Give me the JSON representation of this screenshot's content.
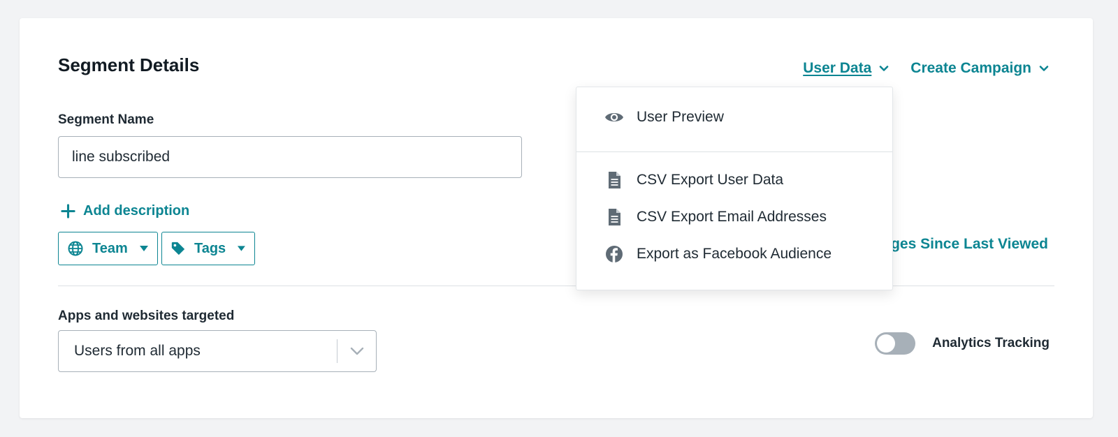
{
  "colors": {
    "accent": "#0c8592",
    "text": "#1f2a33",
    "icon": "#5f6b75"
  },
  "header": {
    "title": "Segment Details",
    "user_data_label": "User Data",
    "create_campaign_label": "Create Campaign"
  },
  "segment_name": {
    "label": "Segment Name",
    "value": "line subscribed"
  },
  "add_description_label": "Add description",
  "pills": {
    "team_label": "Team",
    "tags_label": "Tags"
  },
  "changes_link_label": "ges Since Last Viewed",
  "apps": {
    "label": "Apps and websites targeted",
    "selected": "Users from all apps"
  },
  "analytics": {
    "label": "Analytics Tracking",
    "enabled": false
  },
  "dropdown": {
    "items": [
      {
        "label": "User Preview",
        "icon": "eye-icon"
      },
      {
        "label": "CSV Export User Data",
        "icon": "document-icon"
      },
      {
        "label": "CSV Export Email Addresses",
        "icon": "document-icon"
      },
      {
        "label": "Export as Facebook Audience",
        "icon": "facebook-icon"
      }
    ]
  }
}
